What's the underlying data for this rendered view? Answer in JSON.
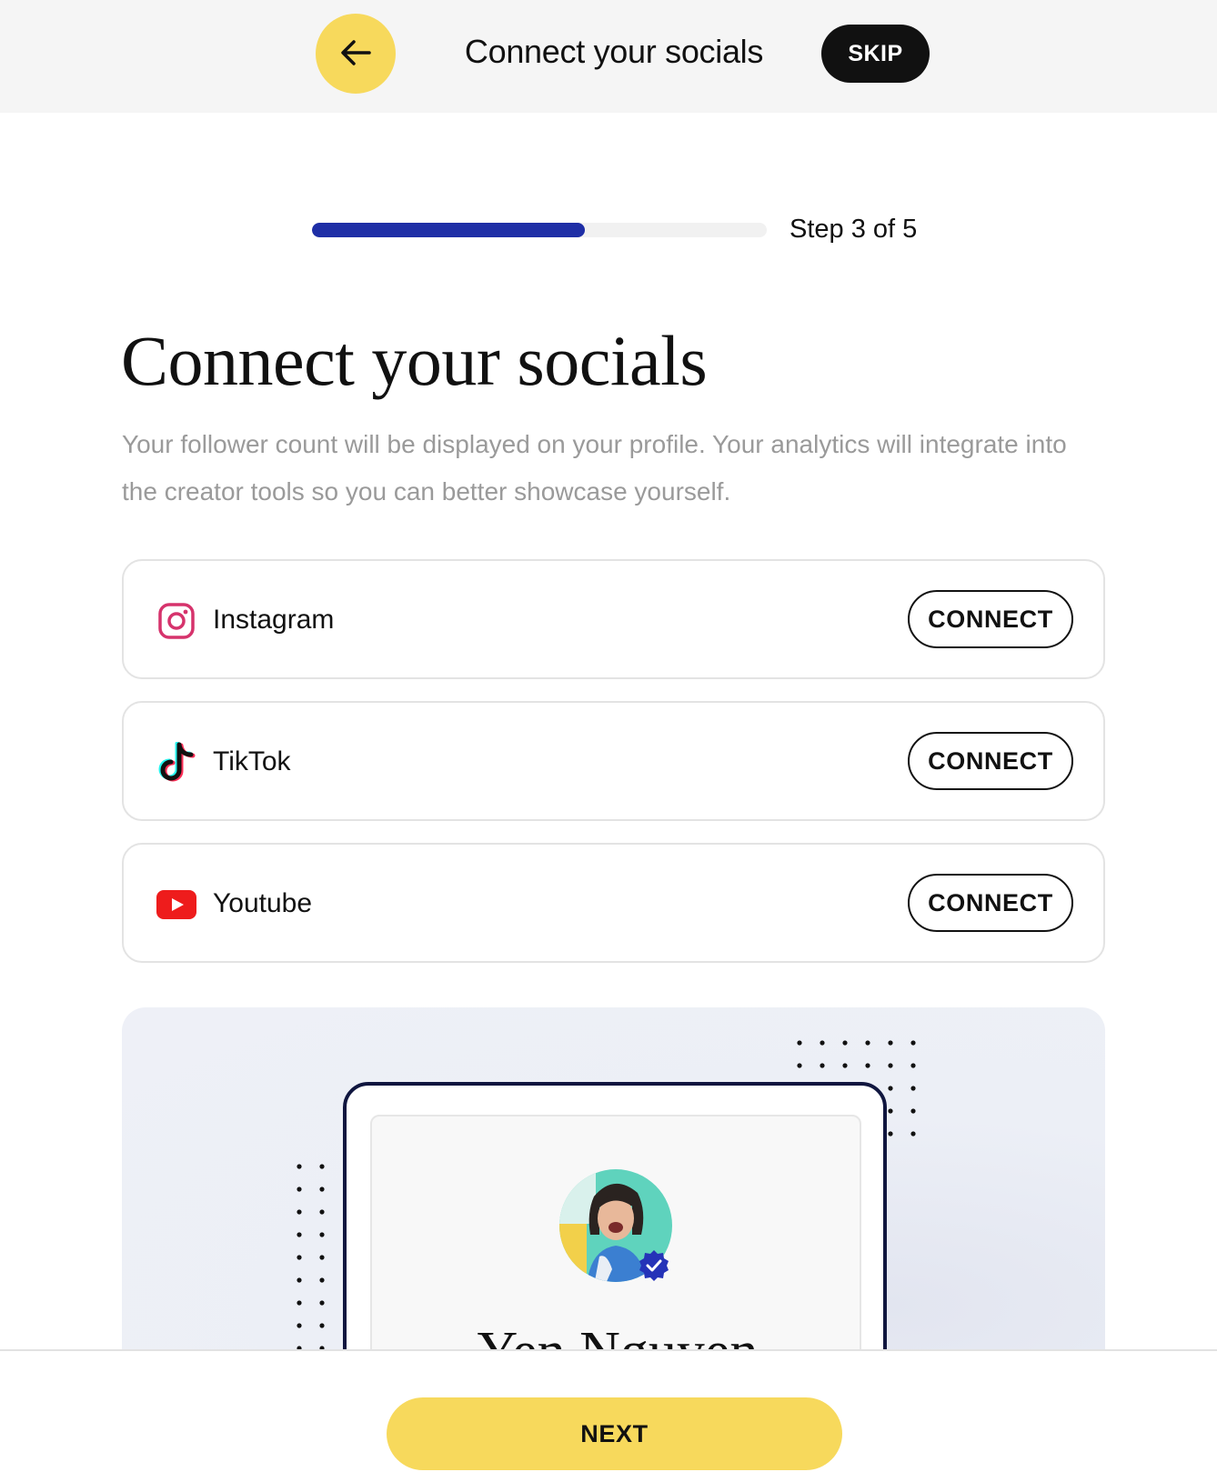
{
  "topbar": {
    "back_icon": "arrow-left-icon",
    "title": "Connect your socials",
    "skip_label": "SKIP"
  },
  "progress": {
    "step_text": "Step 3 of 5",
    "fraction": 0.6,
    "color": "#1e2ea6"
  },
  "main": {
    "heading": "Connect your socials",
    "description": "Your follower count will be displayed on your profile. Your analytics will integrate into the creator tools so you can better showcase yourself."
  },
  "socials": [
    {
      "name": "Instagram",
      "icon": "instagram-icon",
      "button": "CONNECT"
    },
    {
      "name": "TikTok",
      "icon": "tiktok-icon",
      "button": "CONNECT"
    },
    {
      "name": "Youtube",
      "icon": "youtube-icon",
      "button": "CONNECT"
    }
  ],
  "preview": {
    "profile_name": "Yen Nguyen",
    "badge_icon": "verified-badge-icon"
  },
  "footer": {
    "next_label": "NEXT"
  },
  "colors": {
    "accent_yellow": "#f7d95c",
    "progress_blue": "#1e2ea6",
    "instagram": "#d6336c",
    "youtube": "#ff0000"
  }
}
